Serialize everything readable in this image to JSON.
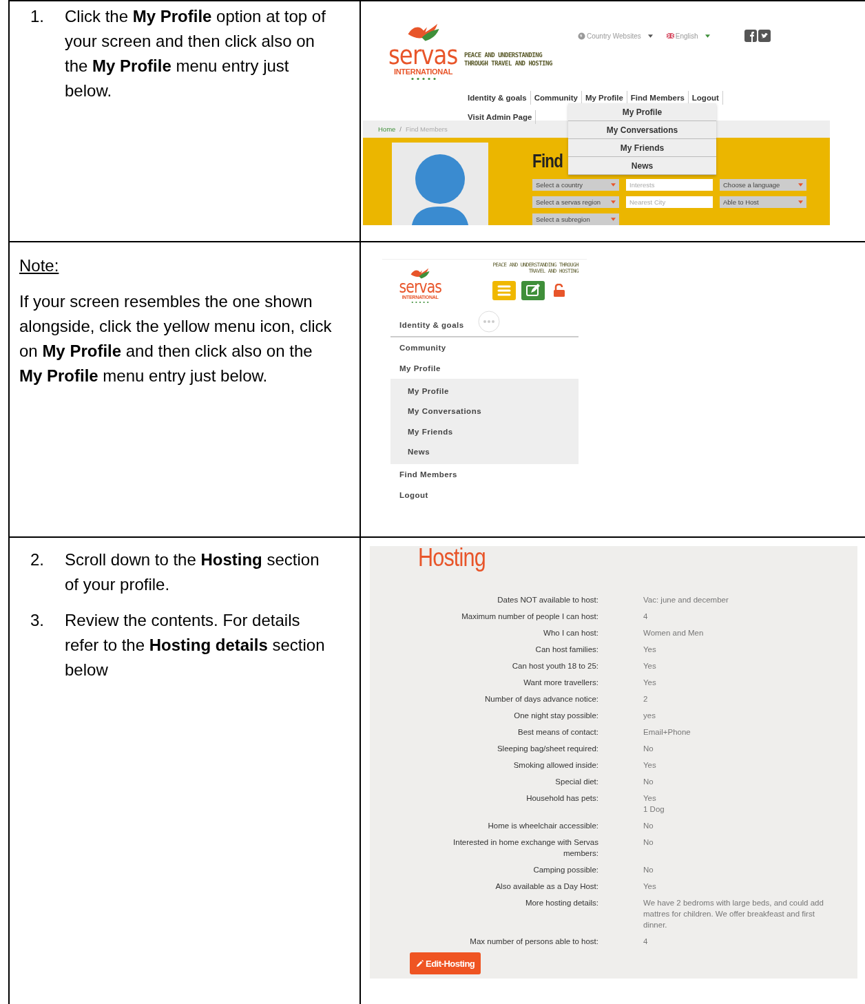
{
  "document": {
    "rows": [
      {
        "left": {
          "kind": "steps",
          "items": [
            {
              "number": "1.",
              "text": "Click the **My Profile** option at top of your screen and then click also on the **My Profile** menu entry just below."
            }
          ]
        },
        "right": {
          "kind": "desktop_site",
          "logo": {
            "name": "servas",
            "subtitle": "INTERNATIONAL"
          },
          "tagline": "PEACE AND UNDERSTANDING THROUGH TRAVEL AND HOSTING",
          "country_link": "Country Websites",
          "language": "English",
          "nav": [
            "Identity & goals",
            "Community",
            "My Profile",
            "Find Members",
            "Logout",
            "Visit Admin Page"
          ],
          "dropdown": [
            "My Profile",
            "My Conversations",
            "My Friends",
            "News"
          ],
          "breadcrumb": [
            {
              "label": "Home",
              "selected": false
            },
            {
              "label": "Find Members",
              "selected": true
            }
          ],
          "breadcrumb_separator": "/",
          "heading": "Find",
          "filters": [
            {
              "kind": "select",
              "text": "Select a country"
            },
            {
              "kind": "input",
              "placeholder": "Interests"
            },
            {
              "kind": "select",
              "text": "Choose a language"
            },
            {
              "kind": "select",
              "text": "Select a servas region"
            },
            {
              "kind": "input",
              "placeholder": "Nearest City"
            },
            {
              "kind": "select",
              "text": "Able to Host"
            },
            {
              "kind": "select",
              "text": "Select a subregion"
            }
          ]
        }
      },
      {
        "left": {
          "kind": "note",
          "heading": "Note:",
          "paragraphs": [
            "If your screen resembles the one shown alongside, click the yellow menu icon, click on **My Profile** and then click also on the\n**My Profile** menu entry just below."
          ]
        },
        "right": {
          "kind": "mobile_site",
          "logo": {
            "name": "servas",
            "subtitle": "INTERNATIONAL"
          },
          "tagline": "PEACE AND UNDERSTANDING THROUGH TRAVEL AND HOSTING",
          "menu": [
            {
              "label": "Identity & goals"
            },
            {
              "label": "Community"
            },
            {
              "label": "My Profile",
              "children": [
                "My Profile",
                "My Conversations",
                "My Friends",
                "News"
              ]
            },
            {
              "label": "Find Members"
            },
            {
              "label": "Logout"
            }
          ]
        }
      },
      {
        "left": {
          "kind": "steps",
          "items": [
            {
              "number": "2.",
              "text": "Scroll down to the **Hosting** section of your profile."
            },
            {
              "number": "3.",
              "text": "Review the contents.  For details refer to the **Hosting details** section below"
            }
          ]
        },
        "right": {
          "kind": "hosting_panel",
          "title": "Hosting",
          "fields": [
            {
              "label": "Dates NOT available to host:",
              "value": [
                "Vac: june and december"
              ]
            },
            {
              "label": "Maximum number of people I can host:",
              "value": [
                "4"
              ]
            },
            {
              "label": "Who I can host:",
              "value": [
                "Women and Men"
              ]
            },
            {
              "label": "Can host families:",
              "value": [
                "Yes"
              ]
            },
            {
              "label": "Can host youth 18 to 25:",
              "value": [
                "Yes"
              ]
            },
            {
              "label": "Want more travellers:",
              "value": [
                "Yes"
              ]
            },
            {
              "label": "Number of days advance notice:",
              "value": [
                "2"
              ]
            },
            {
              "label": "One night stay possible:",
              "value": [
                "yes"
              ]
            },
            {
              "label": "Best means of contact:",
              "value": [
                "Email+Phone"
              ]
            },
            {
              "label": "Sleeping bag/sheet required:",
              "value": [
                "No"
              ]
            },
            {
              "label": "Smoking allowed inside:",
              "value": [
                "Yes"
              ]
            },
            {
              "label": "Special diet:",
              "value": [
                "No"
              ]
            },
            {
              "label": "Household has pets:",
              "value": [
                "Yes",
                "1 Dog"
              ]
            },
            {
              "label": "Home is wheelchair accessible:",
              "value": [
                "No"
              ]
            },
            {
              "label": "Interested in home exchange with Servas members:",
              "value": [
                "No"
              ]
            },
            {
              "label": "Camping possible:",
              "value": [
                "No"
              ]
            },
            {
              "label": "Also available as a Day Host:",
              "value": [
                "Yes"
              ]
            },
            {
              "label": "More hosting details:",
              "value": [
                "We have 2 bedroms with large beds, and could add mattres for children. We offer breakfeast and first dinner."
              ]
            },
            {
              "label": "Max number of persons able to host:",
              "value": [
                "4"
              ]
            }
          ],
          "button": "Edit-Hosting"
        }
      }
    ]
  }
}
